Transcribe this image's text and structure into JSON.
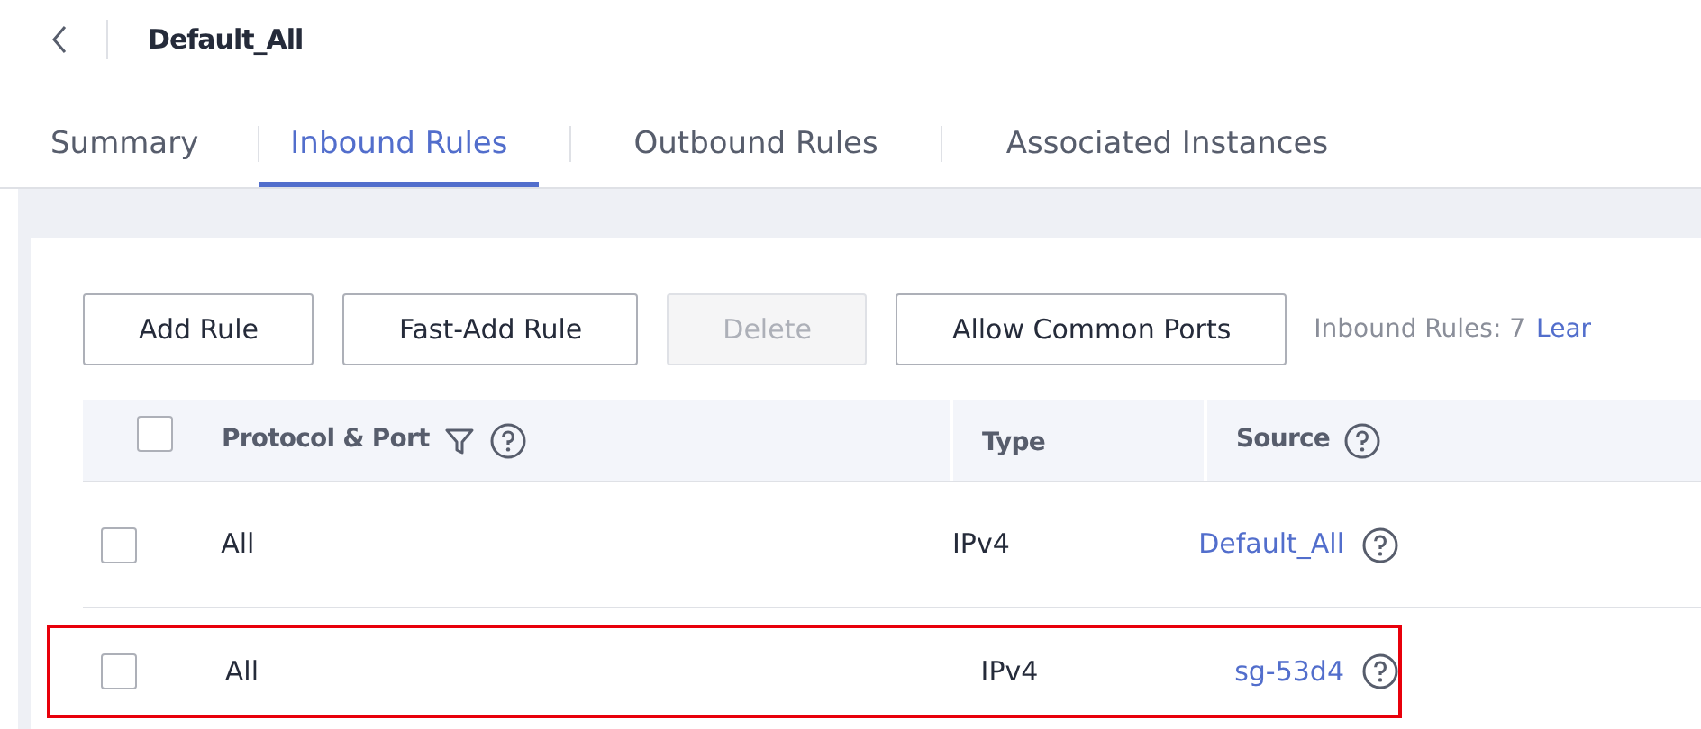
{
  "header": {
    "title": "Default_All"
  },
  "tabs": [
    {
      "label": "Summary",
      "selected": false
    },
    {
      "label": "Inbound Rules",
      "selected": true
    },
    {
      "label": "Outbound Rules",
      "selected": false
    },
    {
      "label": "Associated Instances",
      "selected": false
    }
  ],
  "toolbar": {
    "buttons": [
      {
        "label": "Add Rule",
        "disabled": false
      },
      {
        "label": "Fast-Add Rule",
        "disabled": false
      },
      {
        "label": "Delete",
        "disabled": true
      },
      {
        "label": "Allow Common Ports",
        "disabled": false
      }
    ],
    "count": "Inbound Rules: 7",
    "link": "Lear"
  },
  "table": {
    "select_all": {
      "checked": false
    },
    "columns": [
      "Protocol & Port",
      "Type",
      "Source"
    ],
    "rows": [
      {
        "checked": false,
        "highlighted": false,
        "protocol_port": "All",
        "type": "IPv4",
        "source": "Default_All"
      },
      {
        "checked": false,
        "highlighted": true,
        "protocol_port": "All",
        "type": "IPv4",
        "source": "sg-53d4"
      }
    ]
  }
}
